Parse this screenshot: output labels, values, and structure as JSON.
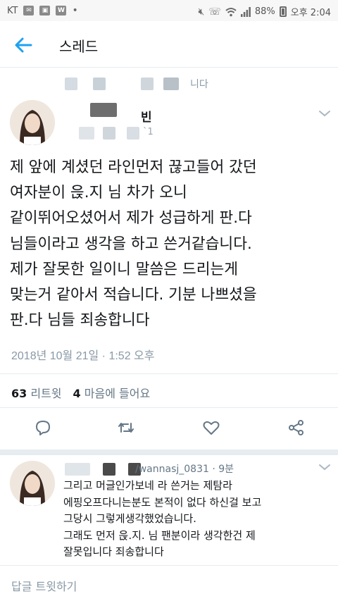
{
  "status_bar": {
    "carrier": "KT",
    "icons_left": [
      "message-icon",
      "image-icon",
      "w-app-icon",
      "dot-icon"
    ],
    "icons_right": [
      "mute-icon",
      "wifi-calling-icon",
      "wifi-icon",
      "signal-icon"
    ],
    "battery": "88%",
    "time": "오후 2:04"
  },
  "appbar": {
    "title": "스레드"
  },
  "context": {
    "suffix": "니다"
  },
  "tweet": {
    "name_suffix": "빈",
    "handle_fragment": "`1",
    "text": "제 앞에 계셨던 라인먼저 끊고들어 갔던\n여자분이 읁.지 님 차가 오니\n같이뛰어오셨어서 제가 성급하게 판.다\n님들이라고 생각을 하고 쓴거같습니다.\n제가 잘못한 일이니 말씀은 드리는게\n맞는거 같아서 적습니다. 기분 나쁘셨을\n판.다 님들 죄송합니다",
    "timestamp": "2018년 10월 21일 · 1:52 오후",
    "retweets_count": "63",
    "retweets_label": "리트윗",
    "likes_count": "4",
    "likes_label": "마음에 들어요",
    "actions": [
      "reply-icon",
      "retweet-icon",
      "like-icon",
      "share-icon"
    ]
  },
  "reply": {
    "handle": "/wannasj_0831 · 9분",
    "text": "그리고 머글인가보네 라 쓴거는 제탐라\n에핑오프다니는분도 본적이 없다 하신걸 보고\n그당시 그렇게생각했었습니다.\n그래도 먼저 읁.지. 님 팬분이라 생각한건 제\n잘못입니다 죄송합니다"
  },
  "compose": {
    "placeholder": "답글 트윗하기"
  },
  "colors": {
    "accent": "#1da1f2",
    "muted": "#8899a6",
    "divider": "#e6ecf0"
  }
}
